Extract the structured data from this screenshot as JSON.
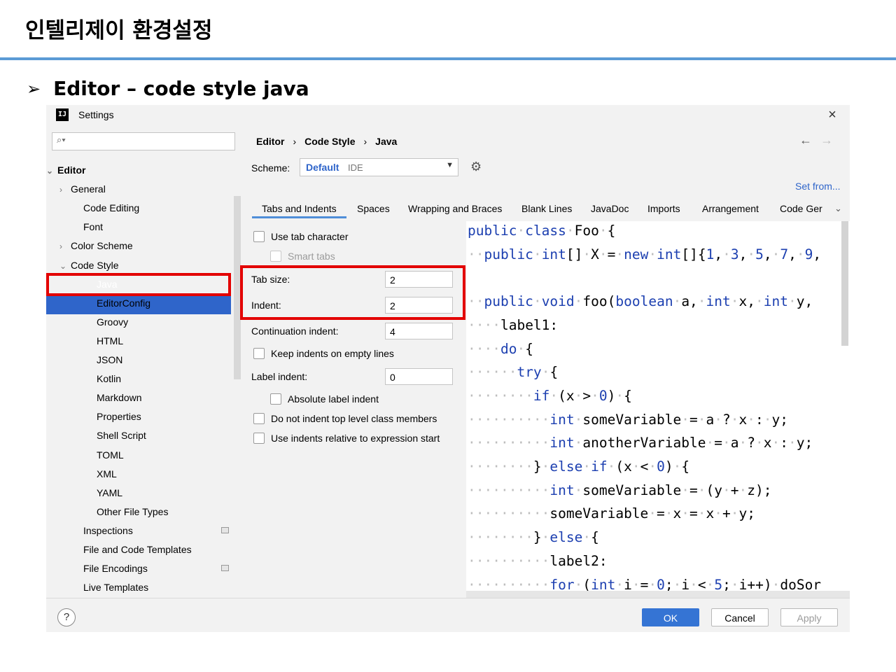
{
  "slide": {
    "title": "인텔리제이 환경설정",
    "bullet_arrow": "➢",
    "bullet": "Editor – code style java"
  },
  "window": {
    "logo": "IJ",
    "title": "Settings",
    "close": "×"
  },
  "sidebar": {
    "search_placeholder": "",
    "items": [
      {
        "label": "Editor",
        "chevron": "⌄"
      },
      {
        "label": "General",
        "chevron": "›"
      },
      {
        "label": "Code Editing"
      },
      {
        "label": "Font"
      },
      {
        "label": "Color Scheme",
        "chevron": "›"
      },
      {
        "label": "Code Style",
        "chevron": "⌄"
      },
      {
        "label": "Java"
      },
      {
        "label": "EditorConfig"
      },
      {
        "label": "Groovy"
      },
      {
        "label": "HTML"
      },
      {
        "label": "JSON"
      },
      {
        "label": "Kotlin"
      },
      {
        "label": "Markdown"
      },
      {
        "label": "Properties"
      },
      {
        "label": "Shell Script"
      },
      {
        "label": "TOML"
      },
      {
        "label": "XML"
      },
      {
        "label": "YAML"
      },
      {
        "label": "Other File Types"
      },
      {
        "label": "Inspections"
      },
      {
        "label": "File and Code Templates"
      },
      {
        "label": "File Encodings"
      },
      {
        "label": "Live Templates"
      }
    ]
  },
  "breadcrumb": [
    "Editor",
    "Code Style",
    "Java"
  ],
  "breadcrumb_sep": "›",
  "nav": {
    "back": "←",
    "forward": "→"
  },
  "scheme": {
    "label": "Scheme:",
    "value": "Default",
    "tag": "IDE",
    "dropdown": "▼",
    "gear": "⚙"
  },
  "set_from": "Set from...",
  "tabs": [
    "Tabs and Indents",
    "Spaces",
    "Wrapping and Braces",
    "Blank Lines",
    "JavaDoc",
    "Imports",
    "Arrangement",
    "Code Ger"
  ],
  "tabs_more": "⌄",
  "options": {
    "use_tab_character": "Use tab character",
    "smart_tabs": "Smart tabs",
    "tab_size_label": "Tab size:",
    "tab_size": "2",
    "indent_label": "Indent:",
    "indent": "2",
    "continuation_label": "Continuation indent:",
    "continuation": "4",
    "keep_indents": "Keep indents on empty lines",
    "label_indent_label": "Label indent:",
    "label_indent": "0",
    "absolute_label": "Absolute label indent",
    "no_indent_top": "Do not indent top level class members",
    "relative_indents": "Use indents relative to expression start"
  },
  "code_lines": [
    [
      [
        "kw",
        "public"
      ],
      [
        "ws",
        "·"
      ],
      [
        "kw",
        "class"
      ],
      [
        "ws",
        "·"
      ],
      [
        "t",
        "Foo"
      ],
      [
        "ws",
        "·"
      ],
      [
        "t",
        "{"
      ]
    ],
    [
      [
        "ws",
        "··"
      ],
      [
        "kw",
        "public"
      ],
      [
        "ws",
        "·"
      ],
      [
        "kw",
        "int"
      ],
      [
        "t",
        "[]"
      ],
      [
        "ws",
        "·"
      ],
      [
        "t",
        "X"
      ],
      [
        "ws",
        "·"
      ],
      [
        "t",
        "="
      ],
      [
        "ws",
        "·"
      ],
      [
        "kw",
        "new"
      ],
      [
        "ws",
        "·"
      ],
      [
        "kw",
        "int"
      ],
      [
        "t",
        "[]{"
      ],
      [
        "num",
        "1"
      ],
      [
        "t",
        ","
      ],
      [
        "ws",
        "·"
      ],
      [
        "num",
        "3"
      ],
      [
        "t",
        ","
      ],
      [
        "ws",
        "·"
      ],
      [
        "num",
        "5"
      ],
      [
        "t",
        ","
      ],
      [
        "ws",
        "·"
      ],
      [
        "num",
        "7"
      ],
      [
        "t",
        ","
      ],
      [
        "ws",
        "·"
      ],
      [
        "num",
        "9"
      ],
      [
        "t",
        ","
      ]
    ],
    [],
    [
      [
        "ws",
        "··"
      ],
      [
        "kw",
        "public"
      ],
      [
        "ws",
        "·"
      ],
      [
        "kw",
        "void"
      ],
      [
        "ws",
        "·"
      ],
      [
        "t",
        "foo("
      ],
      [
        "kw",
        "boolean"
      ],
      [
        "ws",
        "·"
      ],
      [
        "t",
        "a,"
      ],
      [
        "ws",
        "·"
      ],
      [
        "kw",
        "int"
      ],
      [
        "ws",
        "·"
      ],
      [
        "t",
        "x,"
      ],
      [
        "ws",
        "·"
      ],
      [
        "kw",
        "int"
      ],
      [
        "ws",
        "·"
      ],
      [
        "t",
        "y,"
      ]
    ],
    [
      [
        "ws",
        "····"
      ],
      [
        "t",
        "label1:"
      ]
    ],
    [
      [
        "ws",
        "····"
      ],
      [
        "kw",
        "do"
      ],
      [
        "ws",
        "·"
      ],
      [
        "t",
        "{"
      ]
    ],
    [
      [
        "ws",
        "······"
      ],
      [
        "kw",
        "try"
      ],
      [
        "ws",
        "·"
      ],
      [
        "t",
        "{"
      ]
    ],
    [
      [
        "ws",
        "········"
      ],
      [
        "kw",
        "if"
      ],
      [
        "ws",
        "·"
      ],
      [
        "t",
        "(x"
      ],
      [
        "ws",
        "·"
      ],
      [
        "t",
        ">"
      ],
      [
        "ws",
        "·"
      ],
      [
        "num",
        "0"
      ],
      [
        "t",
        ")"
      ],
      [
        "ws",
        "·"
      ],
      [
        "t",
        "{"
      ]
    ],
    [
      [
        "ws",
        "··········"
      ],
      [
        "kw",
        "int"
      ],
      [
        "ws",
        "·"
      ],
      [
        "t",
        "someVariable"
      ],
      [
        "ws",
        "·"
      ],
      [
        "t",
        "="
      ],
      [
        "ws",
        "·"
      ],
      [
        "t",
        "a"
      ],
      [
        "ws",
        "·"
      ],
      [
        "t",
        "?"
      ],
      [
        "ws",
        "·"
      ],
      [
        "t",
        "x"
      ],
      [
        "ws",
        "·"
      ],
      [
        "t",
        ":"
      ],
      [
        "ws",
        "·"
      ],
      [
        "t",
        "y;"
      ]
    ],
    [
      [
        "ws",
        "··········"
      ],
      [
        "kw",
        "int"
      ],
      [
        "ws",
        "·"
      ],
      [
        "t",
        "anotherVariable"
      ],
      [
        "ws",
        "·"
      ],
      [
        "t",
        "="
      ],
      [
        "ws",
        "·"
      ],
      [
        "t",
        "a"
      ],
      [
        "ws",
        "·"
      ],
      [
        "t",
        "?"
      ],
      [
        "ws",
        "·"
      ],
      [
        "t",
        "x"
      ],
      [
        "ws",
        "·"
      ],
      [
        "t",
        ":"
      ],
      [
        "ws",
        "·"
      ],
      [
        "t",
        "y;"
      ]
    ],
    [
      [
        "ws",
        "········"
      ],
      [
        "t",
        "}"
      ],
      [
        "ws",
        "·"
      ],
      [
        "kw",
        "else"
      ],
      [
        "ws",
        "·"
      ],
      [
        "kw",
        "if"
      ],
      [
        "ws",
        "·"
      ],
      [
        "t",
        "(x"
      ],
      [
        "ws",
        "·"
      ],
      [
        "t",
        "<"
      ],
      [
        "ws",
        "·"
      ],
      [
        "num",
        "0"
      ],
      [
        "t",
        ")"
      ],
      [
        "ws",
        "·"
      ],
      [
        "t",
        "{"
      ]
    ],
    [
      [
        "ws",
        "··········"
      ],
      [
        "kw",
        "int"
      ],
      [
        "ws",
        "·"
      ],
      [
        "t",
        "someVariable"
      ],
      [
        "ws",
        "·"
      ],
      [
        "t",
        "="
      ],
      [
        "ws",
        "·"
      ],
      [
        "t",
        "(y"
      ],
      [
        "ws",
        "·"
      ],
      [
        "t",
        "+"
      ],
      [
        "ws",
        "·"
      ],
      [
        "t",
        "z);"
      ]
    ],
    [
      [
        "ws",
        "··········"
      ],
      [
        "t",
        "someVariable"
      ],
      [
        "ws",
        "·"
      ],
      [
        "t",
        "="
      ],
      [
        "ws",
        "·"
      ],
      [
        "t",
        "x"
      ],
      [
        "ws",
        "·"
      ],
      [
        "t",
        "="
      ],
      [
        "ws",
        "·"
      ],
      [
        "t",
        "x"
      ],
      [
        "ws",
        "·"
      ],
      [
        "t",
        "+"
      ],
      [
        "ws",
        "·"
      ],
      [
        "t",
        "y;"
      ]
    ],
    [
      [
        "ws",
        "········"
      ],
      [
        "t",
        "}"
      ],
      [
        "ws",
        "·"
      ],
      [
        "kw",
        "else"
      ],
      [
        "ws",
        "·"
      ],
      [
        "t",
        "{"
      ]
    ],
    [
      [
        "ws",
        "··········"
      ],
      [
        "t",
        "label2:"
      ]
    ],
    [
      [
        "ws",
        "··········"
      ],
      [
        "kw",
        "for"
      ],
      [
        "ws",
        "·"
      ],
      [
        "t",
        "("
      ],
      [
        "kw",
        "int"
      ],
      [
        "ws",
        "·"
      ],
      [
        "t",
        "i"
      ],
      [
        "ws",
        "·"
      ],
      [
        "t",
        "="
      ],
      [
        "ws",
        "·"
      ],
      [
        "num",
        "0"
      ],
      [
        "t",
        ";"
      ],
      [
        "ws",
        "·"
      ],
      [
        "t",
        "i"
      ],
      [
        "ws",
        "·"
      ],
      [
        "t",
        "<"
      ],
      [
        "ws",
        "·"
      ],
      [
        "num",
        "5"
      ],
      [
        "t",
        ";"
      ],
      [
        "ws",
        "·"
      ],
      [
        "t",
        "i++)"
      ],
      [
        "ws",
        "·"
      ],
      [
        "t",
        "doSor"
      ]
    ]
  ],
  "buttons": {
    "help": "?",
    "ok": "OK",
    "cancel": "Cancel",
    "apply": "Apply"
  },
  "colors": {
    "accent": "#2f65ca",
    "highlight": "#e30000",
    "keyword": "#1c3fb0"
  }
}
